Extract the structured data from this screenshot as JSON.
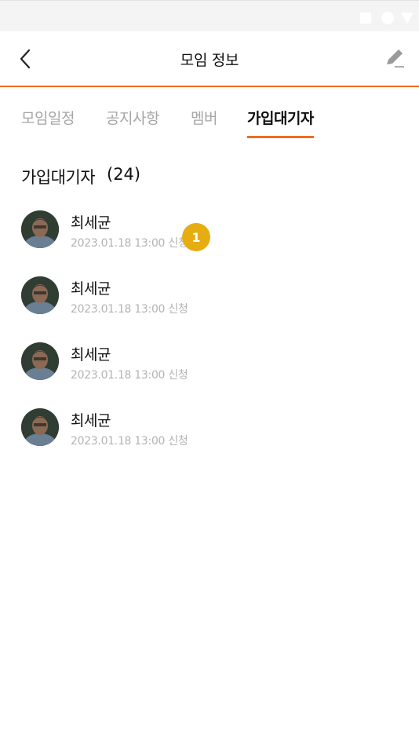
{
  "header": {
    "title": "모임 정보"
  },
  "tabs": [
    {
      "label": "모임일정",
      "active": false
    },
    {
      "label": "공지사항",
      "active": false
    },
    {
      "label": "멤버",
      "active": false
    },
    {
      "label": "가입대기자",
      "active": true
    }
  ],
  "section": {
    "title": "가입대기자",
    "count": "(24)"
  },
  "applicants": [
    {
      "name": "최세균",
      "date": "2023.01.18 13:00",
      "suffix": "신청",
      "badge": "1"
    },
    {
      "name": "최세균",
      "date": "2023.01.18 13:00",
      "suffix": "신청"
    },
    {
      "name": "최세균",
      "date": "2023.01.18 13:00",
      "suffix": "신청"
    },
    {
      "name": "최세균",
      "date": "2023.01.18 13:00",
      "suffix": "신청"
    }
  ],
  "colors": {
    "accent": "#f26a21",
    "badge": "#e6ad13",
    "inactive_tab": "#a6a6a6",
    "meta_text": "#b3b3b3"
  },
  "icons": {
    "back": "chevron-left-icon",
    "edit": "pencil-icon"
  }
}
